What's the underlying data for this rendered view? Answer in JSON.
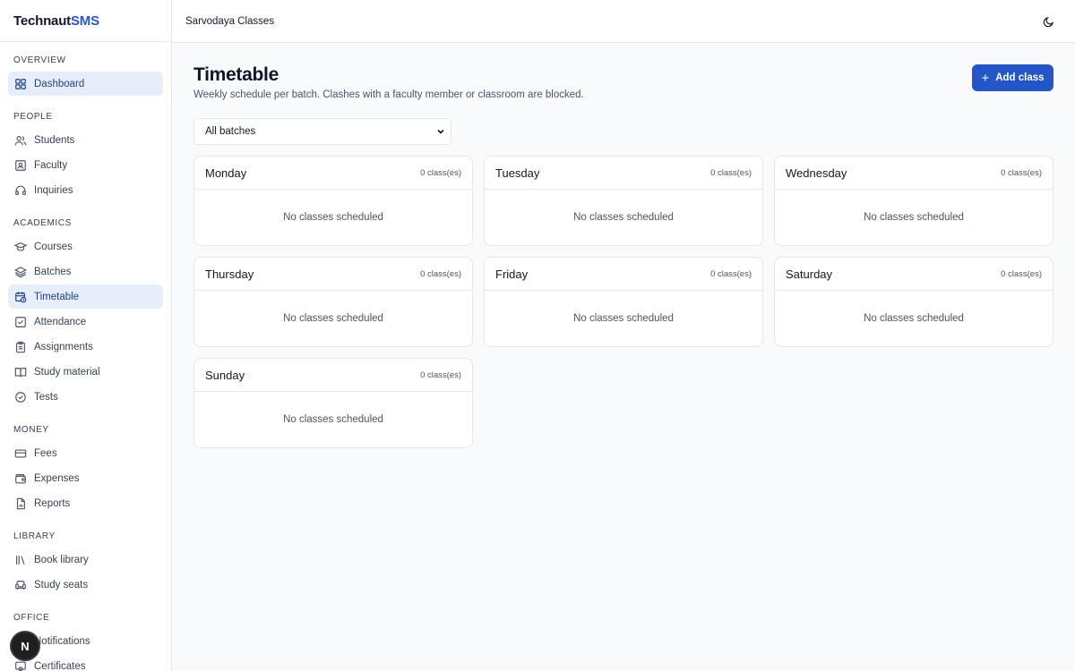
{
  "brand": {
    "name_part1": "Technaut",
    "name_part2": "SMS"
  },
  "org_name": "Sarvodaya Classes",
  "sidebar": {
    "sections": [
      {
        "label": "OVERVIEW",
        "items": [
          {
            "label": "Dashboard",
            "icon": "grid-icon"
          }
        ]
      },
      {
        "label": "PEOPLE",
        "items": [
          {
            "label": "Students",
            "icon": "users-icon"
          },
          {
            "label": "Faculty",
            "icon": "id-card-icon"
          },
          {
            "label": "Inquiries",
            "icon": "headset-icon"
          }
        ]
      },
      {
        "label": "ACADEMICS",
        "items": [
          {
            "label": "Courses",
            "icon": "graduation-cap-icon"
          },
          {
            "label": "Batches",
            "icon": "layers-icon"
          },
          {
            "label": "Timetable",
            "icon": "calendar-clock-icon"
          },
          {
            "label": "Attendance",
            "icon": "check-square-icon"
          },
          {
            "label": "Assignments",
            "icon": "clipboard-icon"
          },
          {
            "label": "Study material",
            "icon": "book-open-icon"
          },
          {
            "label": "Tests",
            "icon": "check-circle-icon"
          }
        ]
      },
      {
        "label": "MONEY",
        "items": [
          {
            "label": "Fees",
            "icon": "credit-card-icon"
          },
          {
            "label": "Expenses",
            "icon": "wallet-icon"
          },
          {
            "label": "Reports",
            "icon": "file-chart-icon"
          }
        ]
      },
      {
        "label": "LIBRARY",
        "items": [
          {
            "label": "Book library",
            "icon": "library-icon"
          },
          {
            "label": "Study seats",
            "icon": "armchair-icon"
          }
        ]
      },
      {
        "label": "OFFICE",
        "items": [
          {
            "label": "Notifications",
            "icon": "megaphone-icon"
          },
          {
            "label": "Certificates",
            "icon": "certificate-icon"
          }
        ]
      }
    ]
  },
  "page": {
    "title": "Timetable",
    "subtitle": "Weekly schedule per batch. Clashes with a faculty member or classroom are blocked.",
    "add_button": "Add class",
    "batch_filter": "All batches"
  },
  "days": [
    {
      "name": "Monday",
      "count": "0 class(es)",
      "empty": "No classes scheduled"
    },
    {
      "name": "Tuesday",
      "count": "0 class(es)",
      "empty": "No classes scheduled"
    },
    {
      "name": "Wednesday",
      "count": "0 class(es)",
      "empty": "No classes scheduled"
    },
    {
      "name": "Thursday",
      "count": "0 class(es)",
      "empty": "No classes scheduled"
    },
    {
      "name": "Friday",
      "count": "0 class(es)",
      "empty": "No classes scheduled"
    },
    {
      "name": "Saturday",
      "count": "0 class(es)",
      "empty": "No classes scheduled"
    },
    {
      "name": "Sunday",
      "count": "0 class(es)",
      "empty": "No classes scheduled"
    }
  ],
  "fab_letter": "N",
  "colors": {
    "accent": "#2456c7",
    "active_bg": "#e6eefa"
  }
}
